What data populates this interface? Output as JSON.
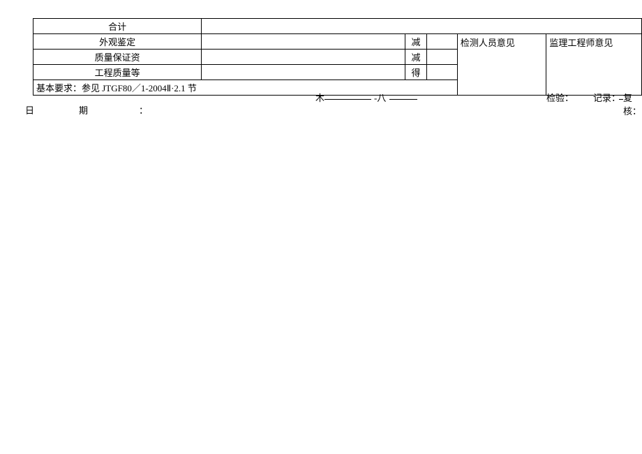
{
  "table": {
    "total_label": "合计",
    "row1": {
      "label": "外观鉴定",
      "deduct": "减"
    },
    "row2": {
      "label": "质量保证资",
      "deduct": "减"
    },
    "row3": {
      "label": "工程质量等",
      "deduct": "得"
    },
    "opinion1": "检测人员意见",
    "opinion2": "监理工程师意见",
    "requirement": "基本要求：参见 JTGF80／1-2004Ⅱ·2.1 节"
  },
  "footer": {
    "wood_text": "木",
    "dash_text": "-八",
    "inspect_label": "检验：",
    "record_label": "记录：",
    "review_label": "复核：",
    "date_label_ri": "日",
    "date_label_qi": "期",
    "colon": "："
  }
}
